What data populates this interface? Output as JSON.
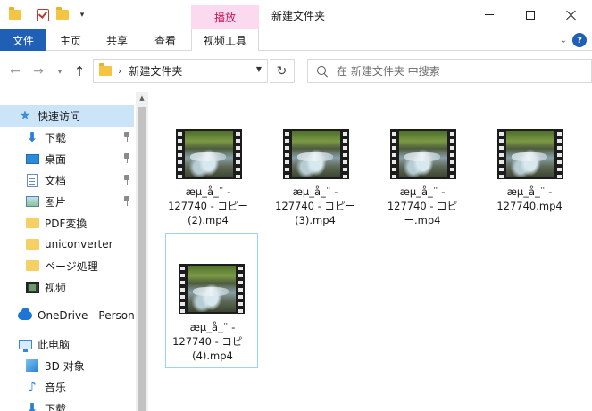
{
  "title_bar": {
    "context_tab_group": "播放",
    "window_title": "新建文件夹"
  },
  "ribbon": {
    "tabs": [
      "文件",
      "主页",
      "共享",
      "查看",
      "视频工具"
    ],
    "help": "?"
  },
  "address_bar": {
    "path": "新建文件夹",
    "search_placeholder": "在 新建文件夹 中搜索"
  },
  "sidebar": {
    "quick_access": "快速访问",
    "items": [
      {
        "label": "下载",
        "icon": "download-icon",
        "pinned": true
      },
      {
        "label": "桌面",
        "icon": "desktop-icon",
        "pinned": true
      },
      {
        "label": "文档",
        "icon": "document-icon",
        "pinned": true
      },
      {
        "label": "图片",
        "icon": "pictures-icon",
        "pinned": true
      },
      {
        "label": "PDF変換",
        "icon": "folder-icon",
        "pinned": false
      },
      {
        "label": "uniconverter",
        "icon": "folder-icon",
        "pinned": false
      },
      {
        "label": "ページ処理",
        "icon": "folder-icon",
        "pinned": false
      },
      {
        "label": "视频",
        "icon": "video-icon",
        "pinned": false
      }
    ],
    "onedrive": "OneDrive - Person",
    "this_pc": "此电脑",
    "pc_items": [
      {
        "label": "3D 对象",
        "icon": "3d-objects-icon"
      },
      {
        "label": "音乐",
        "icon": "music-icon"
      },
      {
        "label": "下载",
        "icon": "download-icon"
      }
    ]
  },
  "files": [
    {
      "line1": "æµ_å_¨ -",
      "line2": "127740 - コピー",
      "line3": "(2).mp4",
      "selected": false
    },
    {
      "line1": "æµ_å_¨ -",
      "line2": "127740 - コピー",
      "line3": "(3).mp4",
      "selected": false
    },
    {
      "line1": "æµ_å_¨ -",
      "line2": "127740 - コピ",
      "line3": "ー.mp4",
      "selected": false
    },
    {
      "line1": "æµ_å_¨ -",
      "line2": "127740.mp4",
      "line3": "",
      "selected": false
    },
    {
      "line1": "æµ_å_¨ -",
      "line2": "127740 - コピー",
      "line3": "(4).mp4",
      "selected": true
    }
  ]
}
